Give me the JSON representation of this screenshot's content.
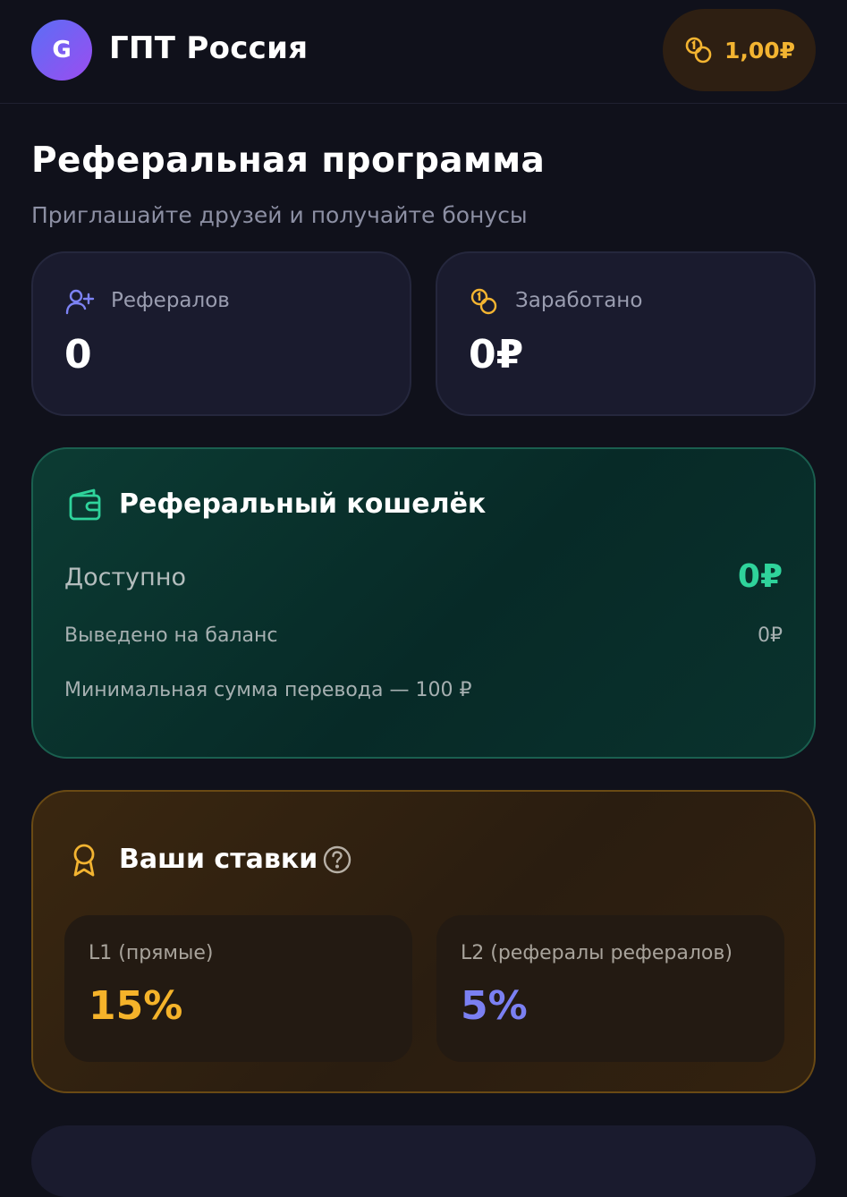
{
  "header": {
    "avatar_letter": "G",
    "app_title": "ГПТ Россия",
    "balance": "1,00₽"
  },
  "page": {
    "title": "Реферальная программа",
    "subtitle": "Приглашайте друзей и получайте бонусы"
  },
  "stats": {
    "referrals": {
      "label": "Рефералов",
      "value": "0",
      "icon": "add-user-icon"
    },
    "earned": {
      "label": "Заработано",
      "value": "0₽",
      "icon": "coins-icon"
    }
  },
  "wallet": {
    "title": "Реферальный кошелёк",
    "available_label": "Доступно",
    "available_value": "0₽",
    "withdrawn_label": "Выведено на баланс",
    "withdrawn_value": "0₽",
    "min_note": "Минимальная сумма перевода — 100 ₽"
  },
  "rates": {
    "title": "Ваши ставки",
    "l1": {
      "label": "L1 (прямые)",
      "value": "15%"
    },
    "l2": {
      "label": "L2 (рефералы рефералов)",
      "value": "5%"
    }
  },
  "colors": {
    "background": "#10111b",
    "accent_gold": "#f3b431",
    "accent_green": "#2fd39b",
    "accent_violet": "#7b80f2"
  }
}
